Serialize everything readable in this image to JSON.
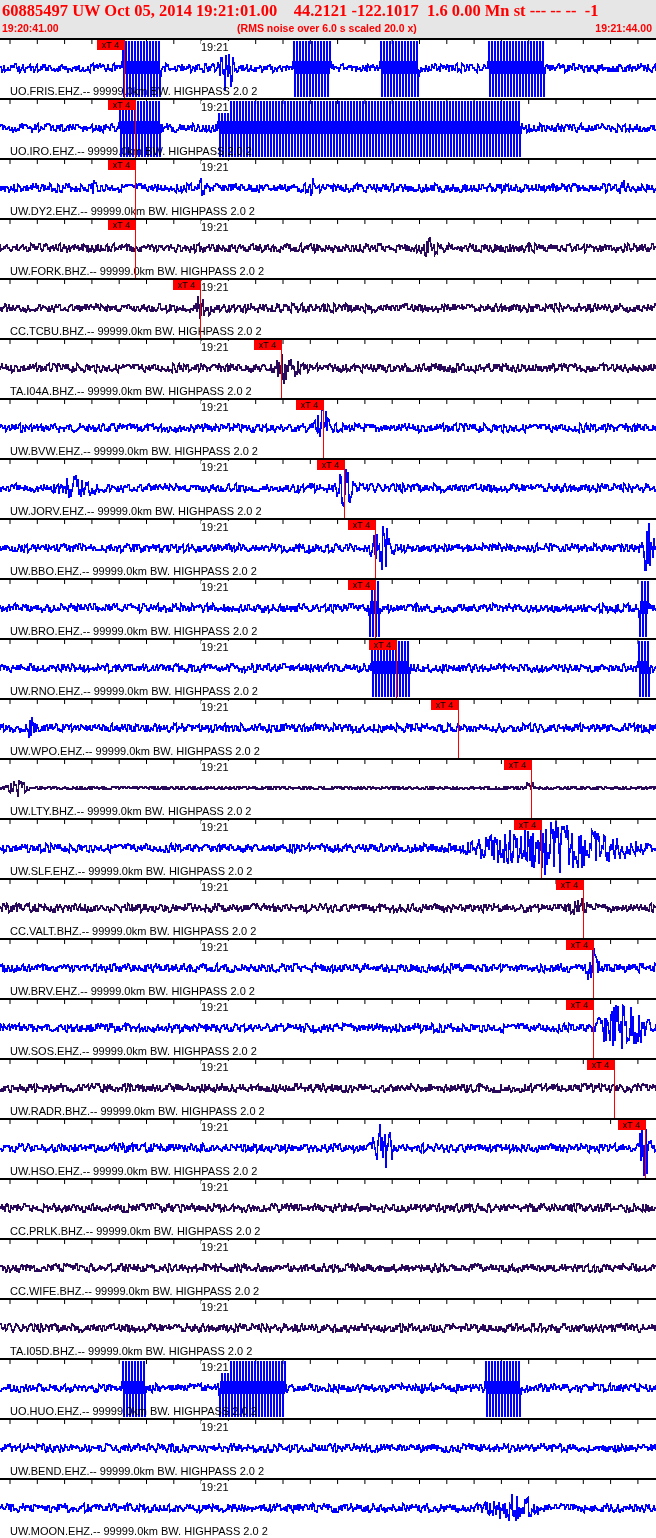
{
  "header": {
    "title": "60885497 UW Oct 05, 2014 19:21:01.00    44.2121 -122.1017  1.6 0.00 Mn st --- -- --  -1",
    "start_time": "19:20:41.00",
    "note": "(RMS noise over 6.0 s scaled 20.0 x)",
    "end_time": "19:21:44.00"
  },
  "traces": [
    {
      "time_label": "19:21",
      "station": "UO.FRIS.EHZ.-- 99999.0km BW. HIGHPASS 2.0 2",
      "color": "#0000ff",
      "pick": "xT 4"
    },
    {
      "time_label": "19:21",
      "station": "UO.IRO.EHZ.-- 99999.0km BW. HIGHPASS 2.0 2",
      "color": "#0000ff",
      "pick": "xT 4"
    },
    {
      "time_label": "19:21",
      "station": "UW.DY2.EHZ.-- 99999.0km BW. HIGHPASS 2.0 2",
      "color": "#0000ff",
      "pick": "xT 4"
    },
    {
      "time_label": "19:21",
      "station": "UW.FORK.BHZ.-- 99999.0km BW. HIGHPASS 2.0 2",
      "color": "#2a0a5a",
      "pick": "xT 4"
    },
    {
      "time_label": "19:21",
      "station": "CC.TCBU.BHZ.-- 99999.0km BW. HIGHPASS 2.0 2",
      "color": "#2a0a5a",
      "pick": "xT 4"
    },
    {
      "time_label": "19:21",
      "station": "TA.I04A.BHZ.-- 99999.0km BW. HIGHPASS 2.0 2",
      "color": "#2a0a5a",
      "pick": "xT 4"
    },
    {
      "time_label": "19:21",
      "station": "UW.BVW.EHZ.-- 99999.0km BW. HIGHPASS 2.0 2",
      "color": "#0000ff",
      "pick": "xT 4"
    },
    {
      "time_label": "19:21",
      "station": "UW.JORV.EHZ.-- 99999.0km BW. HIGHPASS 2.0 2",
      "color": "#0000ff",
      "pick": "xT 4"
    },
    {
      "time_label": "19:21",
      "station": "UW.BBO.EHZ.-- 99999.0km BW. HIGHPASS 2.0 2",
      "color": "#0000ff",
      "pick": "xT 4"
    },
    {
      "time_label": "19:21",
      "station": "UW.BRO.EHZ.-- 99999.0km BW. HIGHPASS 2.0 2",
      "color": "#0000ff",
      "pick": "xT 4"
    },
    {
      "time_label": "19:21",
      "station": "UW.RNO.EHZ.-- 99999.0km BW. HIGHPASS 2.0 2",
      "color": "#0000ff",
      "pick": "xT 4"
    },
    {
      "time_label": "19:21",
      "station": "UW.WPO.EHZ.-- 99999.0km BW. HIGHPASS 2.0 2",
      "color": "#0000ff",
      "pick": "xT 4"
    },
    {
      "time_label": "19:21",
      "station": "UW.LTY.BHZ.-- 99999.0km BW. HIGHPASS 2.0 2",
      "color": "#2a0a5a",
      "pick": "xT 4"
    },
    {
      "time_label": "19:21",
      "station": "UW.SLF.EHZ.-- 99999.0km BW. HIGHPASS 2.0 2",
      "color": "#0000ff",
      "pick": "xT 4"
    },
    {
      "time_label": "19:21",
      "station": "CC.VALT.BHZ.-- 99999.0km BW. HIGHPASS 2.0 2",
      "color": "#2a0a5a",
      "pick": "xT 4"
    },
    {
      "time_label": "19:21",
      "station": "UW.BRV.EHZ.-- 99999.0km BW. HIGHPASS 2.0 2",
      "color": "#0000ff",
      "pick": "xT 4"
    },
    {
      "time_label": "19:21",
      "station": "UW.SOS.EHZ.-- 99999.0km BW. HIGHPASS 2.0 2",
      "color": "#0000ff",
      "pick": "xT 4"
    },
    {
      "time_label": "19:21",
      "station": "UW.RADR.BHZ.-- 99999.0km BW. HIGHPASS 2.0 2",
      "color": "#2a0a5a",
      "pick": "xT 4"
    },
    {
      "time_label": "19:21",
      "station": "UW.HSO.EHZ.-- 99999.0km BW. HIGHPASS 2.0 2",
      "color": "#0000ff",
      "pick": "xT 4"
    },
    {
      "time_label": "19:21",
      "station": "CC.PRLK.BHZ.-- 99999.0km BW. HIGHPASS 2.0 2",
      "color": "#2a0a5a"
    },
    {
      "time_label": "19:21",
      "station": "CC.WIFE.BHZ.-- 99999.0km BW. HIGHPASS 2.0 2",
      "color": "#2a0a5a"
    },
    {
      "time_label": "19:21",
      "station": "TA.I05D.BHZ.-- 99999.0km BW. HIGHPASS 2.0 2",
      "color": "#2a0a5a"
    },
    {
      "time_label": "19:21",
      "station": "UO.HUO.EHZ.-- 99999.0km BW. HIGHPASS 2.0 2",
      "color": "#0000ff"
    },
    {
      "time_label": "19:21",
      "station": "UW.BEND.EHZ.-- 99999.0km BW. HIGHPASS 2.0 2",
      "color": "#0000ff"
    },
    {
      "time_label": "19:21",
      "station": "UW.MOON.EHZ.-- 99999.0km BW. HIGHPASS 2.0 2",
      "color": "#0000ff"
    }
  ]
}
